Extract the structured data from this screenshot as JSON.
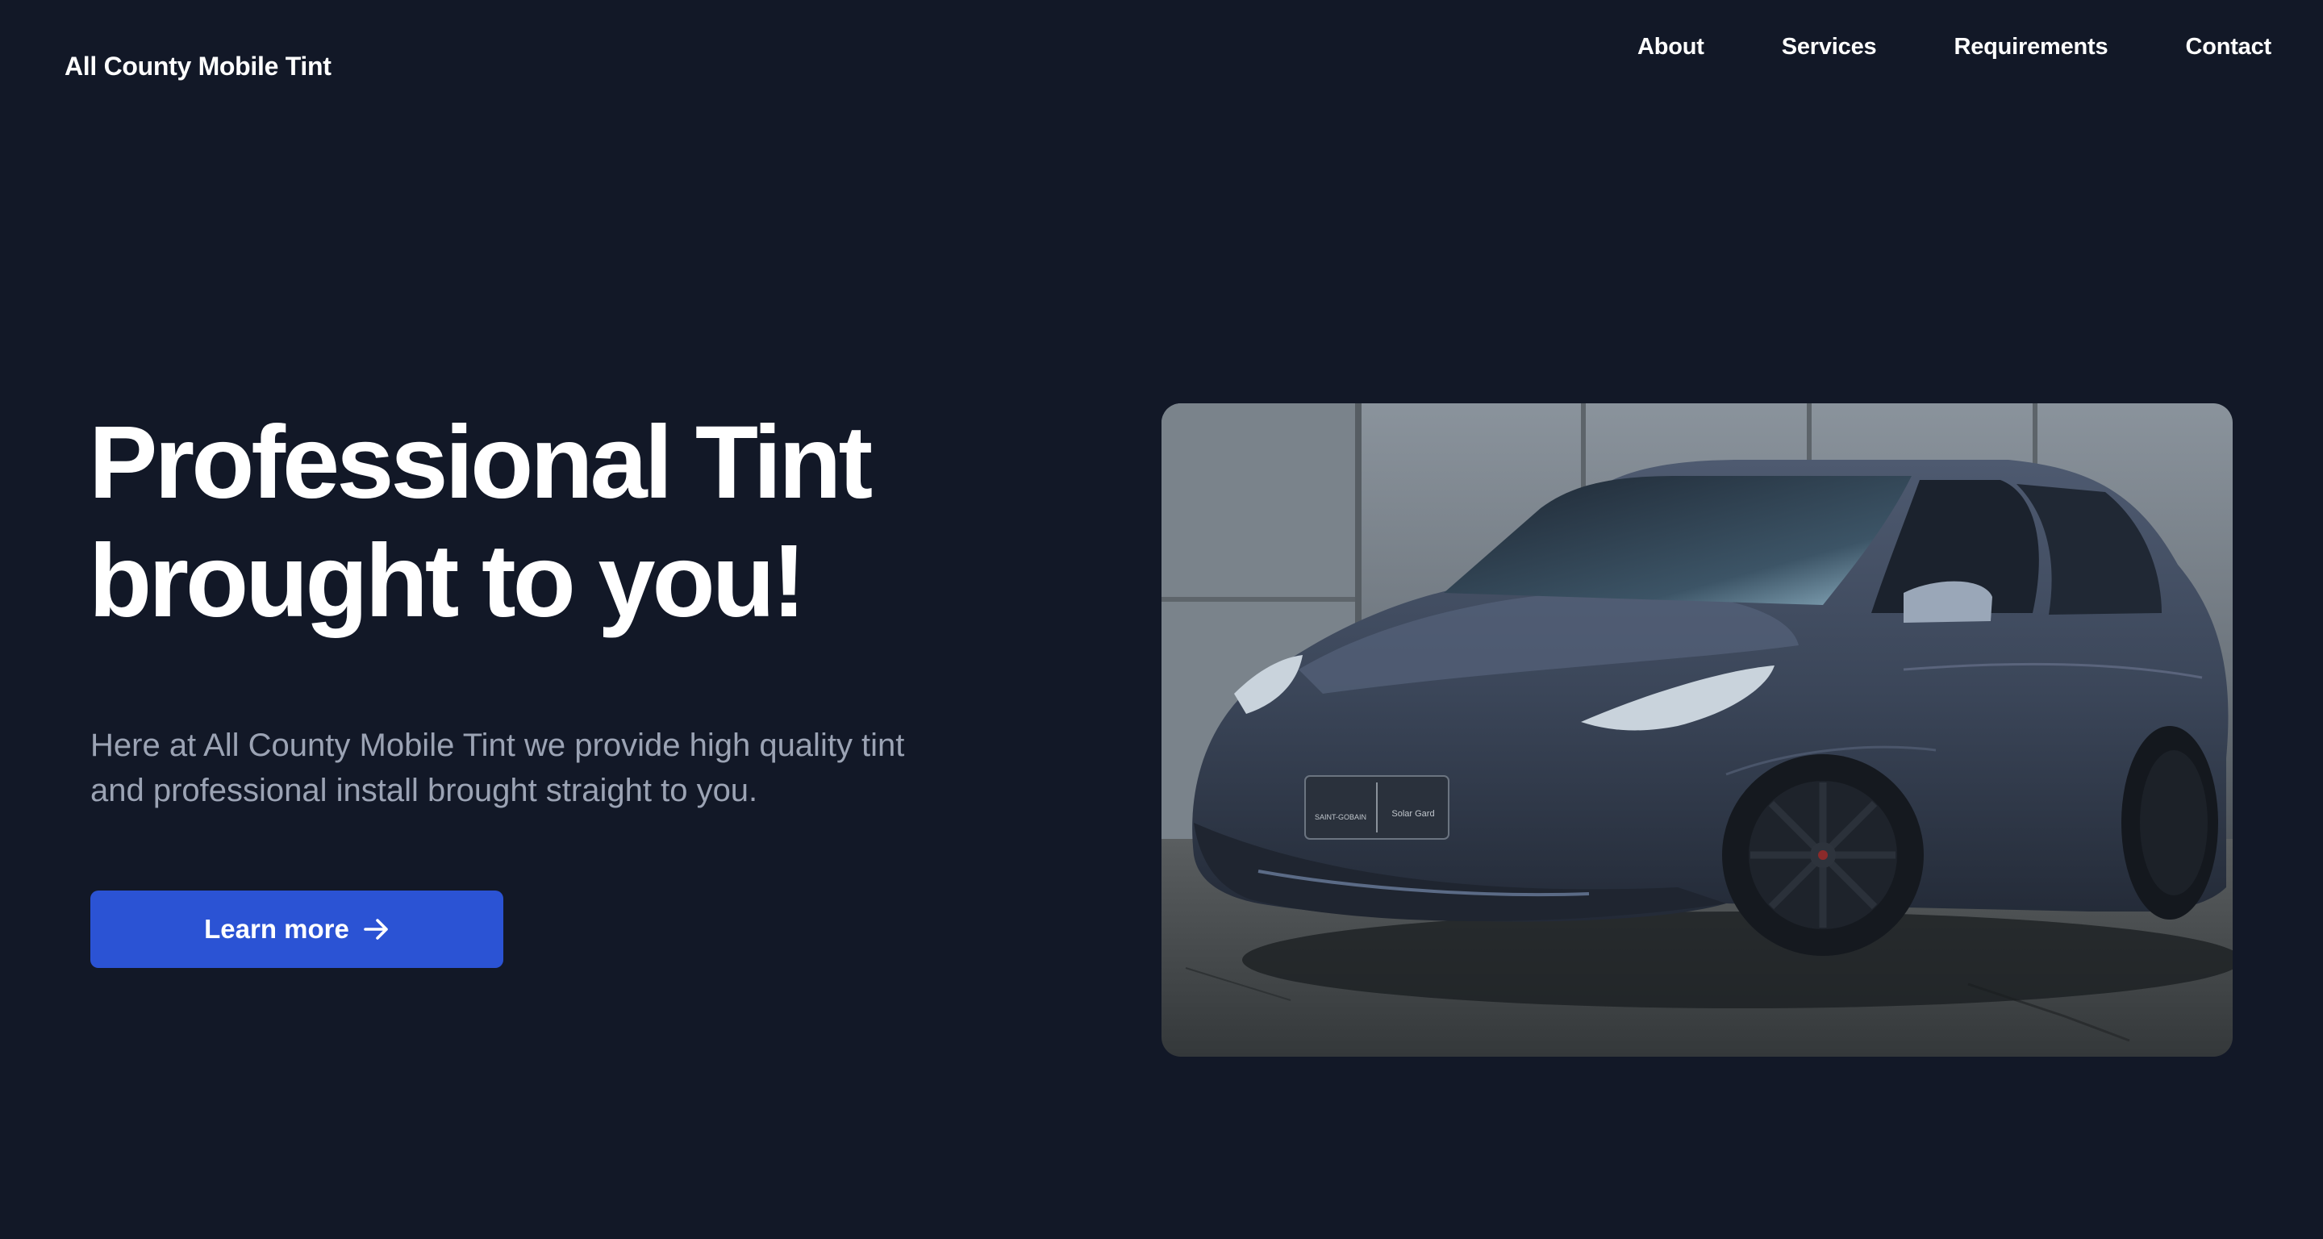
{
  "header": {
    "brand": "All County Mobile Tint",
    "nav": [
      {
        "label": "About"
      },
      {
        "label": "Services"
      },
      {
        "label": "Requirements"
      },
      {
        "label": "Contact"
      }
    ]
  },
  "hero": {
    "title_line1": "Professional Tint",
    "title_line2": "brought to you!",
    "subtitle": "Here at All County Mobile Tint we provide high quality tint and professional install brought straight to you.",
    "cta_label": "Learn more",
    "cta_icon": "arrow-right-icon",
    "image": {
      "subject": "matte dark blue-grey car parked against a weathered concrete wall",
      "plate_left": "SAINT-GOBAIN",
      "plate_right": "Solar Gard"
    }
  },
  "colors": {
    "background": "#121827",
    "text_primary": "#ffffff",
    "text_muted": "#9ba3b4",
    "accent": "#2b53d4"
  }
}
